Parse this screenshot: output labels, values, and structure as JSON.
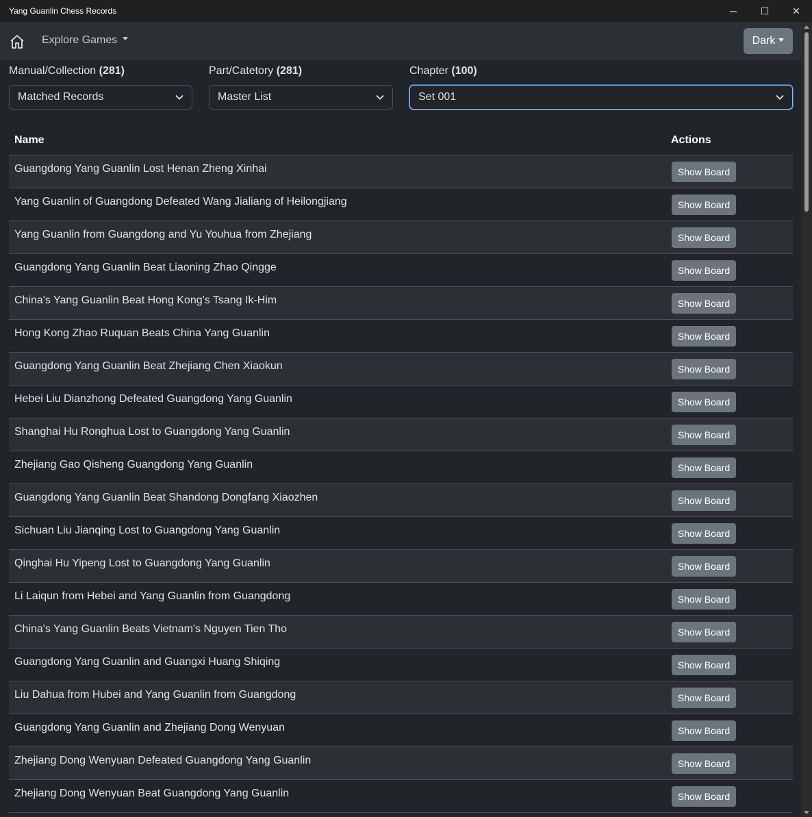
{
  "window": {
    "title": "Yang Guanlin Chess Records",
    "minimize": "─",
    "maximize": "☐",
    "close": "✕"
  },
  "navbar": {
    "home_icon": "home-icon",
    "explore_label": "Explore Games",
    "theme_label": "Dark"
  },
  "filters": {
    "manual": {
      "label": "Manual/Collection",
      "count": "(281)",
      "value": "Matched Records"
    },
    "part": {
      "label": "Part/Catetory",
      "count": "(281)",
      "value": "Master List"
    },
    "chapter": {
      "label": "Chapter",
      "count": "(100)",
      "value": "Set 001"
    }
  },
  "table": {
    "headers": {
      "name": "Name",
      "actions": "Actions"
    },
    "action_label": "Show Board",
    "rows": [
      "Guangdong Yang Guanlin Lost Henan Zheng Xinhai",
      "Yang Guanlin of Guangdong Defeated Wang Jialiang of Heilongjiang",
      "Yang Guanlin from Guangdong and Yu Youhua from Zhejiang",
      "Guangdong Yang Guanlin Beat Liaoning Zhao Qingge",
      "China's Yang Guanlin Beat Hong Kong's Tsang Ik-Him",
      "Hong Kong Zhao Ruquan Beats China Yang Guanlin",
      "Guangdong Yang Guanlin Beat Zhejiang Chen Xiaokun",
      "Hebei Liu Dianzhong Defeated Guangdong Yang Guanlin",
      "Shanghai Hu Ronghua Lost to Guangdong Yang Guanlin",
      "Zhejiang Gao Qisheng Guangdong Yang Guanlin",
      "Guangdong Yang Guanlin Beat Shandong Dongfang Xiaozhen",
      "Sichuan Liu Jianqing Lost to Guangdong Yang Guanlin",
      "Qinghai Hu Yipeng Lost to Guangdong Yang Guanlin",
      "Li Laiqun from Hebei and Yang Guanlin from Guangdong",
      "China's Yang Guanlin Beats Vietnam's Nguyen Tien Tho",
      "Guangdong Yang Guanlin and Guangxi Huang Shiqing",
      "Liu Dahua from Hubei and Yang Guanlin from Guangdong",
      "Guangdong Yang Guanlin and Zhejiang Dong Wenyuan",
      "Zhejiang Dong Wenyuan Defeated Guangdong Yang Guanlin",
      "Zhejiang Dong Wenyuan Beat Guangdong Yang Guanlin"
    ]
  }
}
